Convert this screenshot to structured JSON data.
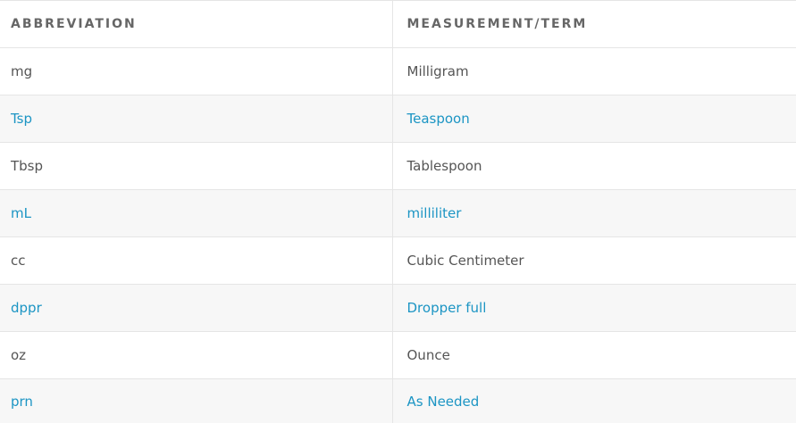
{
  "table": {
    "headers": [
      "ABBREVIATION",
      "MEASUREMENT/TERM"
    ],
    "rows": [
      [
        "mg",
        "Milligram"
      ],
      [
        "Tsp",
        "Teaspoon"
      ],
      [
        "Tbsp",
        "Tablespoon"
      ],
      [
        "mL",
        "milliliter"
      ],
      [
        "cc",
        "Cubic Centimeter"
      ],
      [
        "dppr",
        "Dropper full"
      ],
      [
        "oz",
        "Ounce"
      ],
      [
        "prn",
        "As Needed"
      ]
    ],
    "link_color": "#1c95c4",
    "text_color": "#555555",
    "header_color": "#666666",
    "alt_row_background": "#f7f7f7"
  }
}
